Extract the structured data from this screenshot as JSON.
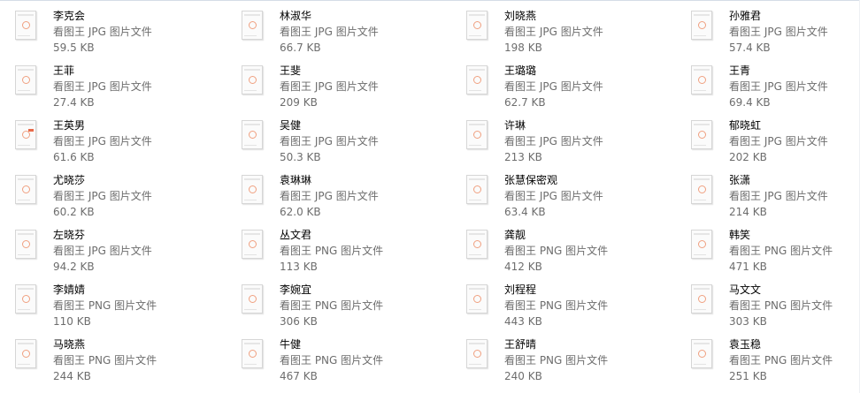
{
  "files": [
    {
      "name": "李克会",
      "type": "看图王 JPG 图片文件",
      "size": "59.5 KB"
    },
    {
      "name": "林淑华",
      "type": "看图王 JPG 图片文件",
      "size": "66.7 KB"
    },
    {
      "name": "刘晓燕",
      "type": "看图王 JPG 图片文件",
      "size": "198 KB"
    },
    {
      "name": "孙雅君",
      "type": "看图王 JPG 图片文件",
      "size": "57.4 KB"
    },
    {
      "name": "王菲",
      "type": "看图王 JPG 图片文件",
      "size": "27.4 KB"
    },
    {
      "name": "王斐",
      "type": "看图王 JPG 图片文件",
      "size": "209 KB"
    },
    {
      "name": "王璐璐",
      "type": "看图王 JPG 图片文件",
      "size": "62.7 KB"
    },
    {
      "name": "王青",
      "type": "看图王 JPG 图片文件",
      "size": "69.4 KB"
    },
    {
      "name": "王英男",
      "type": "看图王 JPG 图片文件",
      "size": "61.6 KB"
    },
    {
      "name": "吴健",
      "type": "看图王 JPG 图片文件",
      "size": "50.3 KB"
    },
    {
      "name": "许琳",
      "type": "看图王 JPG 图片文件",
      "size": "213 KB"
    },
    {
      "name": "郁晓虹",
      "type": "看图王 JPG 图片文件",
      "size": "202 KB"
    },
    {
      "name": "尤晓莎",
      "type": "看图王 JPG 图片文件",
      "size": "60.2 KB"
    },
    {
      "name": "袁琳琳",
      "type": "看图王 JPG 图片文件",
      "size": "62.0 KB"
    },
    {
      "name": "张慧保密观",
      "type": "看图王 JPG 图片文件",
      "size": "63.4 KB"
    },
    {
      "name": "张潇",
      "type": "看图王 JPG 图片文件",
      "size": "214 KB"
    },
    {
      "name": "左晓芬",
      "type": "看图王 JPG 图片文件",
      "size": "94.2 KB"
    },
    {
      "name": "丛文君",
      "type": "看图王 PNG 图片文件",
      "size": "113 KB"
    },
    {
      "name": "龚靓",
      "type": "看图王 PNG 图片文件",
      "size": "412 KB"
    },
    {
      "name": "韩笑",
      "type": "看图王 PNG 图片文件",
      "size": "471 KB"
    },
    {
      "name": "李婧婧",
      "type": "看图王 PNG 图片文件",
      "size": "110 KB"
    },
    {
      "name": "李婉宜",
      "type": "看图王 PNG 图片文件",
      "size": "306 KB"
    },
    {
      "name": "刘程程",
      "type": "看图王 PNG 图片文件",
      "size": "443 KB"
    },
    {
      "name": "马文文",
      "type": "看图王 PNG 图片文件",
      "size": "303 KB"
    },
    {
      "name": "马晓燕",
      "type": "看图王 PNG 图片文件",
      "size": "244 KB"
    },
    {
      "name": "牛健",
      "type": "看图王 PNG 图片文件",
      "size": "467 KB"
    },
    {
      "name": "王舒晴",
      "type": "看图王 PNG 图片文件",
      "size": "240 KB"
    },
    {
      "name": "袁玉稳",
      "type": "看图王 PNG 图片文件",
      "size": "251 KB"
    }
  ],
  "colors": {
    "name_text": "#000000",
    "detail_text": "#6d6d6d",
    "thumb_accent": "#f0a080",
    "thumb_badge": "#e86a4a"
  },
  "icons": {
    "file_thumbnail": "image-file-thumbnail-icon"
  }
}
